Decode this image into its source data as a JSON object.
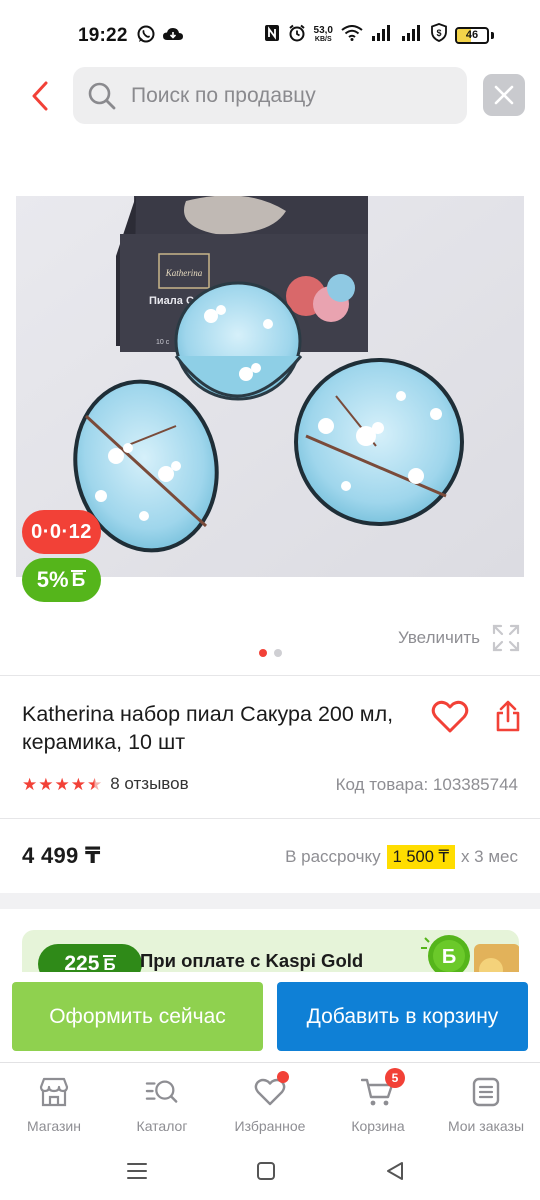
{
  "status_bar": {
    "time": "19:22",
    "net_speed_value": "53,0",
    "net_speed_unit": "KB/S",
    "battery_level": "46",
    "battery_fraction": 0.46
  },
  "header": {
    "search_placeholder": "Поиск по продавцу"
  },
  "gallery": {
    "image_box_text_brand": "Katherina",
    "image_box_text_label": "Пиала С",
    "image_box_text_small": "10 с",
    "timer_badge": "0·0·12",
    "bonus_badge_value": "5%",
    "bonus_badge_symbol": "Б",
    "slide_count": 2,
    "active_slide": 1,
    "zoom_label": "Увеличить"
  },
  "product": {
    "title": "Katherina набор пиал Сакура 200 мл, керамика, 10 шт",
    "rating": 4.5,
    "reviews_label": "8 отзывов",
    "sku_label": "Код товара: 103385744",
    "price": "4 499 ₸",
    "installment_prefix": "В рассрочку",
    "installment_amount": "1 500 ₸",
    "installment_suffix": "х 3 мес"
  },
  "kaspi_banner": {
    "bonus_amount": "225",
    "bonus_symbol": "Б",
    "text": "При оплате с Kaspi Gold",
    "art_symbol": "Б"
  },
  "actions": {
    "checkout_label": "Оформить сейчас",
    "add_to_cart_label": "Добавить в корзину"
  },
  "bottom_nav": {
    "items": [
      {
        "label": "Магазин",
        "icon": "shop-icon"
      },
      {
        "label": "Каталог",
        "icon": "catalog-search-icon"
      },
      {
        "label": "Избранное",
        "icon": "heart-icon",
        "has_dot": true
      },
      {
        "label": "Корзина",
        "icon": "cart-icon",
        "count": "5"
      },
      {
        "label": "Мои заказы",
        "icon": "orders-icon"
      }
    ]
  },
  "colors": {
    "accent_red": "#f24137",
    "checkout_green": "#8fd14f",
    "cart_blue": "#0f80d6",
    "bonus_green": "#55b51b",
    "installment_yellow": "#ffdd00"
  }
}
